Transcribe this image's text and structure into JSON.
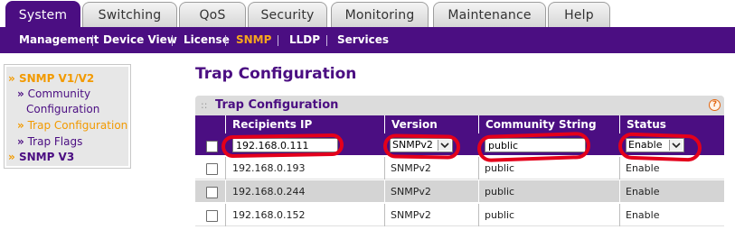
{
  "tabs": [
    {
      "label": "System",
      "active": true
    },
    {
      "label": "Switching"
    },
    {
      "label": "QoS"
    },
    {
      "label": "Security"
    },
    {
      "label": "Monitoring"
    },
    {
      "label": "Maintenance"
    },
    {
      "label": "Help"
    }
  ],
  "subnav": [
    "Management",
    "Device View",
    "License",
    "SNMP",
    "LLDP",
    "Services"
  ],
  "subnav_active": "SNMP",
  "sidebar": {
    "section1": "SNMP V1/V2",
    "items": [
      "Community Configuration",
      "Trap Configuration",
      "Trap Flags"
    ],
    "item1_line1": "Community",
    "item1_line2": "Configuration",
    "active_item": "Trap Configuration",
    "section2": "SNMP V3"
  },
  "page_title": "Trap Configuration",
  "panel": {
    "title": "Trap Configuration",
    "help_glyph": "?",
    "columns": [
      "Recipients IP",
      "Version",
      "Community String",
      "Status"
    ]
  },
  "edit_row": {
    "ip": "192.168.0.111",
    "version": "SNMPv2",
    "community": "public",
    "status": "Enable"
  },
  "rows": [
    {
      "ip": "192.168.0.193",
      "version": "SNMPv2",
      "community": "public",
      "status": "Enable"
    },
    {
      "ip": "192.168.0.244",
      "version": "SNMPv2",
      "community": "public",
      "status": "Enable"
    },
    {
      "ip": "192.168.0.152",
      "version": "SNMPv2",
      "community": "public",
      "status": "Enable"
    }
  ],
  "colors": {
    "brand_purple": "#4b0e82",
    "accent_orange": "#f29a00",
    "annotation_red": "#e4001b"
  }
}
